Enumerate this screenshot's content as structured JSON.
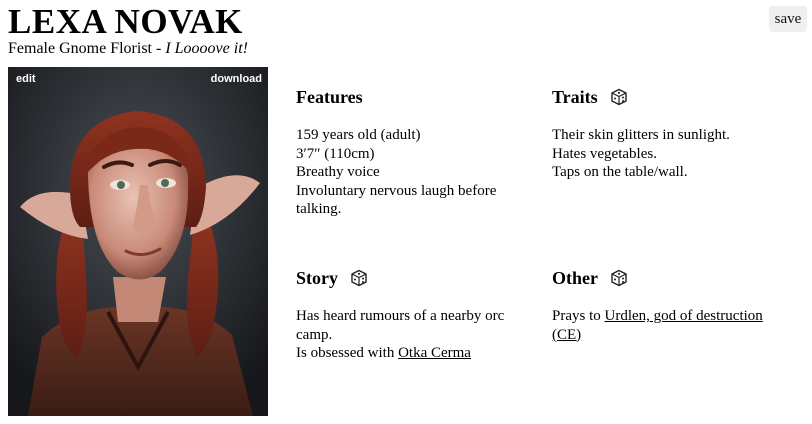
{
  "character": {
    "name": "LEXA NOVAK",
    "descriptor": "Female Gnome Florist",
    "separator": " - ",
    "quote": "I Loooove it!"
  },
  "actions": {
    "save_label": "save"
  },
  "portrait": {
    "edit_label": "edit",
    "download_label": "download"
  },
  "features": {
    "heading": "Features",
    "lines": [
      "159 years old (adult)",
      "3′7″ (110cm)",
      "Breathy voice",
      "Involuntary nervous laugh before talking."
    ]
  },
  "traits": {
    "heading": "Traits",
    "lines": [
      "Their skin glitters in sunlight.",
      "Hates vegetables.",
      "Taps on the table/wall."
    ]
  },
  "story": {
    "heading": "Story",
    "line1": "Has heard rumours of a nearby orc camp.",
    "line2_prefix": "Is obsessed with ",
    "line2_link": "Otka Cerma"
  },
  "other": {
    "heading": "Other",
    "prefix": "Prays to ",
    "link": "Urdlen, god of destruction (CE)"
  },
  "icons": {
    "reroll": "dice-icon"
  }
}
